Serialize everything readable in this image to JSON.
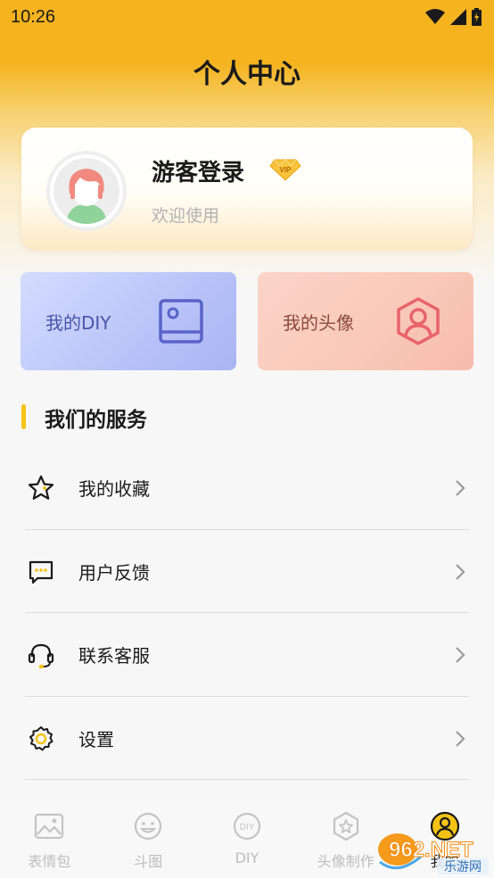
{
  "status": {
    "time": "10:26"
  },
  "header": {
    "title": "个人中心"
  },
  "profile": {
    "name": "游客登录",
    "subtitle": "欢迎使用",
    "badge": "VIP"
  },
  "tiles": [
    {
      "label": "我的DIY",
      "icon": "picture-frame-icon"
    },
    {
      "label": "我的头像",
      "icon": "user-hexagon-icon"
    }
  ],
  "section": {
    "title": "我们的服务"
  },
  "menu": [
    {
      "label": "我的收藏",
      "icon": "star-icon"
    },
    {
      "label": "用户反馈",
      "icon": "chat-bubble-icon"
    },
    {
      "label": "联系客服",
      "icon": "headset-icon"
    },
    {
      "label": "设置",
      "icon": "gear-icon"
    }
  ],
  "tabbar": [
    {
      "label": "表情包",
      "icon": "image-icon",
      "active": false
    },
    {
      "label": "斗图",
      "icon": "smiley-icon",
      "active": false
    },
    {
      "label": "DIY",
      "icon": "diy-icon",
      "active": false
    },
    {
      "label": "头像制作",
      "icon": "badge-star-icon",
      "active": false
    },
    {
      "label": "我的",
      "icon": "user-icon",
      "active": true
    }
  ],
  "watermark": {
    "text": "962.NET",
    "sub": "乐游网"
  },
  "colors": {
    "accent": "#f4b31f",
    "section_bar": "#f5c315",
    "diy_tile": "#b9c3f8",
    "avatar_tile": "#f9c8b8"
  }
}
